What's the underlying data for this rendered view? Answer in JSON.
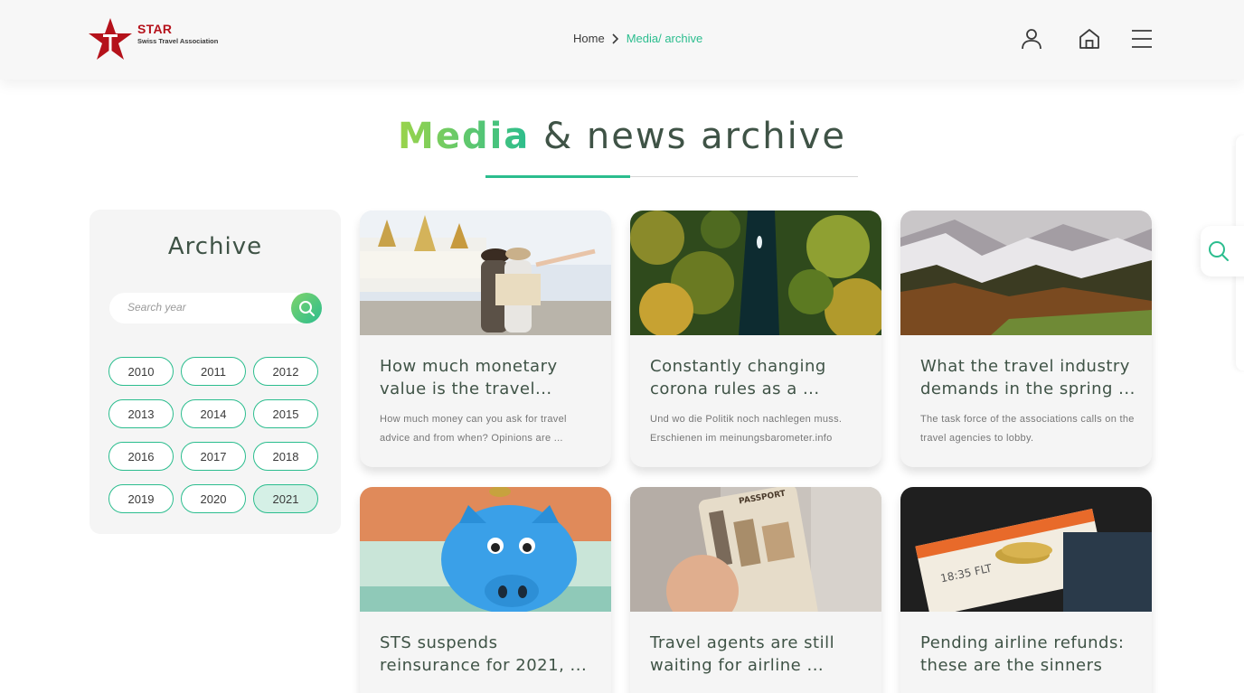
{
  "header": {
    "logo": {
      "name": "STAR",
      "subtitle": "Swiss Travel Association"
    },
    "breadcrumb": {
      "home": "Home",
      "current": "Media/ archive"
    },
    "icons": [
      "user-icon",
      "home-icon",
      "menu-icon"
    ]
  },
  "main": {
    "title_accent": "Media",
    "title_rest": " & news archive"
  },
  "archive": {
    "title": "Archive",
    "search_placeholder": "Search year",
    "years": [
      "2010",
      "2011",
      "2012",
      "2013",
      "2014",
      "2015",
      "2016",
      "2017",
      "2018",
      "2019",
      "2020",
      "2021"
    ],
    "selected_year": "2021"
  },
  "cards": [
    {
      "title": "How much monetary value is the travel...",
      "desc": "How much money can you ask for travel advice and from when? Opinions are ..."
    },
    {
      "title": "Constantly changing corona rules as a ...",
      "desc": "Und wo die Politik noch nachlegen muss. Erschienen im meinungsbarometer.info"
    },
    {
      "title": "What the travel industry demands in the spring ...",
      "desc": "The task force of the associations calls on the travel agencies to lobby."
    },
    {
      "title": "STS suspends reinsurance for 2021, ...",
      "desc": ""
    },
    {
      "title": "Travel agents are still waiting for airline ...",
      "desc": ""
    },
    {
      "title": "Pending airline refunds: these are the sinners",
      "desc": ""
    }
  ],
  "colors": {
    "accent": "#2bbd8e",
    "accent_light": "#9bd44a",
    "brand_red": "#b5121b",
    "heading": "#3f5346"
  }
}
